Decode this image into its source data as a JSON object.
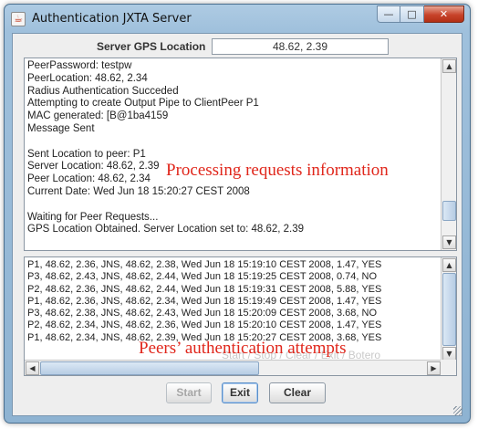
{
  "window": {
    "title": "Authentication JXTA Server",
    "icon": "java-cup-icon",
    "controls": {
      "minimize": "—",
      "maximize": "□",
      "close": "✕"
    }
  },
  "gps": {
    "label": "Server GPS Location",
    "value": "48.62, 2.39"
  },
  "text_area": {
    "lines": [
      "PeerPassword: testpw",
      "PeerLocation: 48.62, 2.34",
      "Radius Authentication Succeded",
      "Attempting to create Output Pipe to ClientPeer P1",
      "MAC generated: [B@1ba4159",
      "Message Sent",
      "",
      "Sent Location to peer: P1",
      "Server Location: 48.62, 2.39",
      "Peer Location: 48.62, 2.34",
      "Current Date: Wed Jun 18 15:20:27 CEST 2008",
      "",
      "Waiting for Peer Requests...",
      "GPS Location Obtained. Server Location set to: 48.62, 2.39"
    ],
    "annotation": "Processing requests information"
  },
  "log_area": {
    "rows": [
      "P1, 48.62, 2.36, JNS, 48.62, 2.38, Wed Jun 18 15:19:10 CEST 2008, 1.47, YES",
      "P3, 48.62, 2.43, JNS, 48.62, 2.44, Wed Jun 18 15:19:25 CEST 2008, 0.74, NO",
      "P2, 48.62, 2.36, JNS, 48.62, 2.44, Wed Jun 18 15:19:31 CEST 2008, 5.88, YES",
      "P1, 48.62, 2.36, JNS, 48.62, 2.34, Wed Jun 18 15:19:49 CEST 2008, 1.47, YES",
      "P3, 48.62, 2.38, JNS, 48.62, 2.43, Wed Jun 18 15:20:09 CEST 2008, 3.68, NO",
      "P2, 48.62, 2.34, JNS, 48.62, 2.36, Wed Jun 18 15:20:10 CEST 2008, 1.47, YES",
      "P1, 48.62, 2.34, JNS, 48.62, 2.39, Wed Jun 18 15:20:27 CEST 2008, 3.68, YES"
    ],
    "annotation": "Peers’ authentication attempts",
    "faded_text": "Start / Stop / Clear / Exit / Botero"
  },
  "buttons": {
    "start": "Start",
    "exit": "Exit",
    "clear": "Clear"
  },
  "scrollbar_arrows": {
    "up": "▲",
    "down": "▼",
    "left": "◀",
    "right": "▶"
  },
  "colors": {
    "annotation": "#e0261b",
    "close_button": "#c7432a",
    "title_gradient_top": "#aecbe3"
  }
}
